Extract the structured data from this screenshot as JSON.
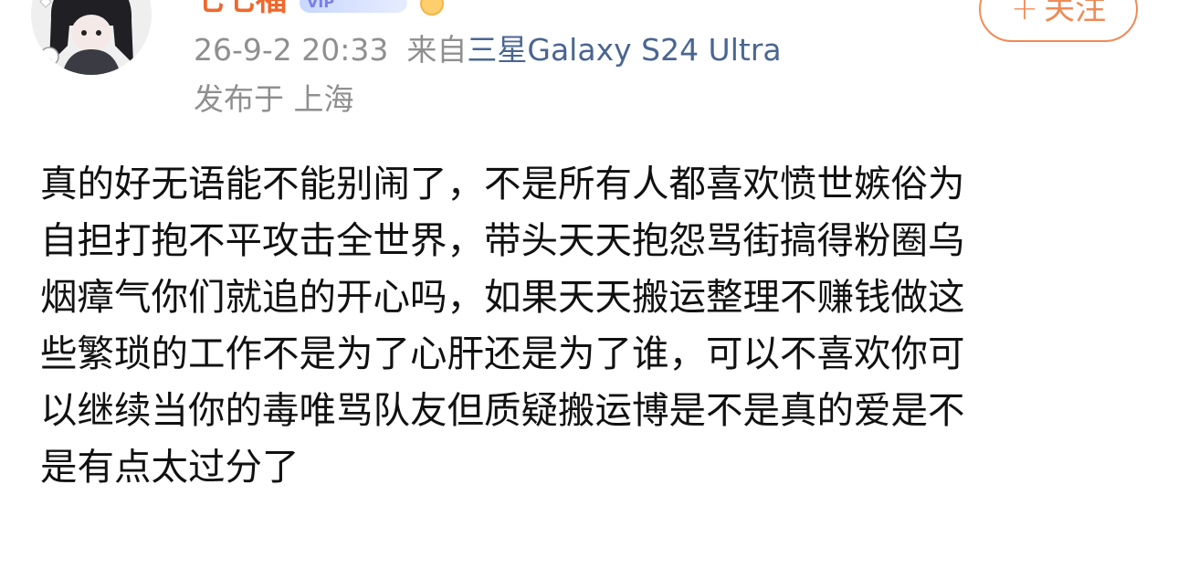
{
  "user": {
    "name": "七七福",
    "vip_badge": "VIP"
  },
  "follow": {
    "plus": "+",
    "label": "关注"
  },
  "meta": {
    "timestamp": "26-9-2 20:33",
    "source_prefix": "来自",
    "device": "三星Galaxy S24 Ultra",
    "location": "发布于 上海"
  },
  "post": {
    "lines": [
      "真的好无语能不能别闹了，不是所有人都喜欢愤世嫉俗为",
      "自担打抱不平攻击全世界，带头天天抱怨骂街搞得粉圈乌",
      "烟瘴气你们就追的开心吗，如果天天搬运整理不赚钱做这",
      "些繁琐的工作不是为了心肝还是为了谁，可以不喜欢你可",
      "以继续当你的毒唯骂队友但质疑搬运博是不是真的爱是不",
      "是有点太过分了"
    ]
  },
  "colors": {
    "username": "#f0672c",
    "follow_accent": "#f08a56",
    "meta_gray": "#8f8f8f",
    "device_link": "#4a6691",
    "body_text": "#111111"
  }
}
